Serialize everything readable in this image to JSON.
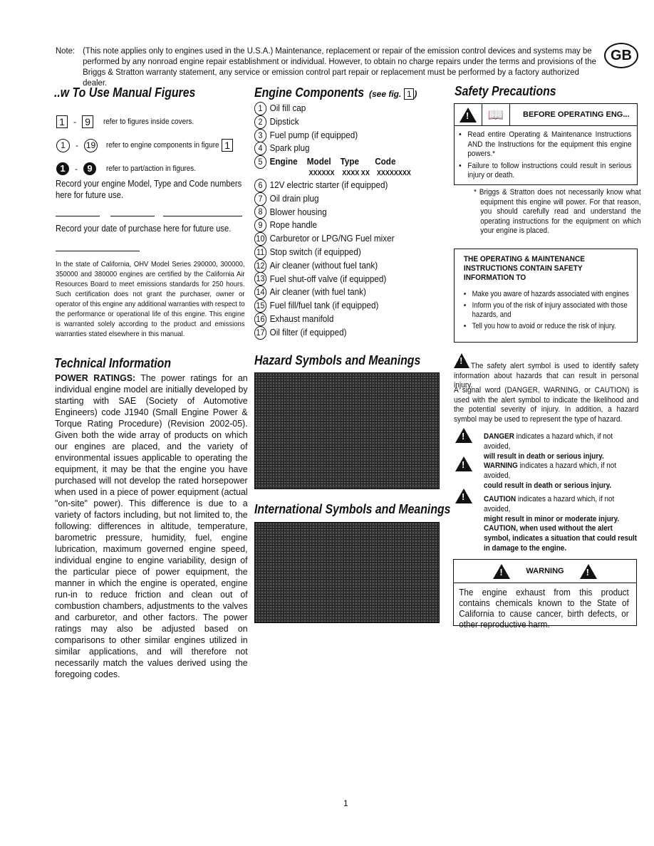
{
  "note": {
    "label": "Note:",
    "text": "(This note applies only to engines used in the U.S.A.) Maintenance, replacement or repair of the emission control devices and systems may be performed by any nonroad engine repair establishment or individual. However, to obtain no charge repairs under the terms and provisions of the Briggs & Stratton warranty statement, any service or emission control part repair or replacement must be performed by a factory authorized dealer.",
    "badge": "GB"
  },
  "howto": {
    "title": "..w To Use Manual Figures",
    "fig_from": "1",
    "fig_to": "9",
    "fig_text": "refer to figures inside covers.",
    "comp_from": "1",
    "comp_to": "19",
    "comp_text": "refer to engine components in figure",
    "comp_fig": "1",
    "part_from": "1",
    "part_to": "9",
    "part_text": "refer to part/action in figures.",
    "record_engine": "Record your engine Model, Type and Code numbers here for future use.",
    "record_date": "Record your date of purchase here for future use.",
    "california": "In the state of California, OHV Model Series 290000, 300000, 350000 and 380000 engines are certified by the California Air Resources Board to meet emissions standards for 250 hours. Such certification does not grant the purchaser, owner or operator of this engine any additional warranties with respect to the performance or operational life of this engine. This engine is warranted solely according to the product and emissions warranties stated elsewhere in this manual."
  },
  "components": {
    "title": "Engine Components",
    "subtitle": "(see fig.",
    "fig": "1",
    "items": [
      {
        "n": "1",
        "label": "Oil fill cap"
      },
      {
        "n": "2",
        "label": "Dipstick"
      },
      {
        "n": "3",
        "label": "Fuel pump (if equipped)"
      },
      {
        "n": "4",
        "label": "Spark plug"
      },
      {
        "n": "5",
        "label": "Engine"
      },
      {
        "n": "6",
        "label": "12V electric starter (if equipped)"
      },
      {
        "n": "7",
        "label": "Oil drain plug"
      },
      {
        "n": "8",
        "label": "Blower housing"
      },
      {
        "n": "9",
        "label": "Rope handle"
      },
      {
        "n": "10",
        "label": "Carburetor or LPG/NG Fuel mixer"
      },
      {
        "n": "11",
        "label": "Stop switch (if equipped)"
      },
      {
        "n": "12",
        "label": "Air cleaner (without fuel tank)"
      },
      {
        "n": "13",
        "label": "Fuel shut-off valve (if equipped)"
      },
      {
        "n": "14",
        "label": "Air cleaner (with fuel tank)"
      },
      {
        "n": "15",
        "label": "Fuel fill/fuel tank (if equipped)"
      },
      {
        "n": "16",
        "label": "Exhaust manifold"
      },
      {
        "n": "17",
        "label": "Oil filter (if equipped)"
      }
    ],
    "engine_cols": {
      "model": "Model",
      "type": "Type",
      "code": "Code",
      "model_v": "XXXXXX",
      "type_v": "XXXX XX",
      "code_v": "XXXXXXXX"
    }
  },
  "technical": {
    "title": "Technical Information",
    "lead": "POWER RATINGS:",
    "text": "The power ratings for an individual engine model are initially developed by starting with SAE (Society of Automotive Engineers) code J1940 (Small Engine Power & Torque Rating Procedure) (Revision 2002-05). Given both the wide array of products on which our engines are placed, and the variety of environmental issues applicable to operating the equipment, it may be that the engine you have purchased will not develop the rated horsepower when used in a piece of power equipment (actual \"on-site\" power). This difference is due to a variety of factors including, but not limited to, the following: differences in altitude, temperature, barometric pressure, humidity, fuel, engine lubrication, maximum governed engine speed, individual engine to engine variability, design of the particular piece of power equipment, the manner in which the engine is operated, engine run-in to reduce friction and clean out of combustion chambers, adjustments to the valves and carburetor, and other factors. The power ratings may also be adjusted based on comparisons to other similar engines utilized in similar applications, and will therefore not necessarily match the values derived using the foregoing codes."
  },
  "hazard": {
    "title": "Hazard Symbols and Meanings"
  },
  "international": {
    "title": "International Symbols and Meanings"
  },
  "safety": {
    "title": "Safety Precautions",
    "before_heading": "BEFORE OPERATING ENG...",
    "before_items": [
      "Read entire Operating & Maintenance Instructions AND the Instructions for the equipment this engine powers.*",
      "Failure to follow instructions could result in serious injury or death."
    ],
    "footnote": "* Briggs & Stratton does not necessarily know what equipment this engine will power. For that reason, you should carefully read and understand the operating instructions for the equipment on which your engine is placed.",
    "om_heading": "THE OPERATING & MAINTENANCE INSTRUCTIONS CONTAIN SAFETY INFORMATION TO",
    "om_items": [
      "Make you aware of hazards associated with engines",
      "Inform you of the risk of injury associated with those hazards, and",
      "Tell you how to avoid or reduce the risk of injury."
    ],
    "alert_text": "The safety alert symbol is used to identify safety information about hazards that can result in personal injury.",
    "signal_text": "A signal word (DANGER, WARNING, or CAUTION) is used with the alert symbol to indicate the likelihood and the potential severity of injury. In addition, a hazard symbol may be used to represent the type of hazard.",
    "danger_word": "DANGER",
    "danger_text": "indicates a hazard which, if not avoided,",
    "danger_bold": "will result in death or serious injury.",
    "warning_word": "WARNING",
    "warning_text": "indicates a hazard which, if not avoided,",
    "warning_bold": "could result in death or serious injury.",
    "caution_word": "CAUTION",
    "caution_text": "indicates a hazard which, if not avoided,",
    "caution_bold": "might result in minor or moderate injury.",
    "caution2": "CAUTION, when used without the alert symbol, indicates a situation that could result in damage to the engine.",
    "prop65_heading": "WARNING",
    "prop65_text": "The engine exhaust from this product contains chemicals known to the State of California to cause cancer, birth defects, or other reproductive harm."
  },
  "page_number": "1"
}
